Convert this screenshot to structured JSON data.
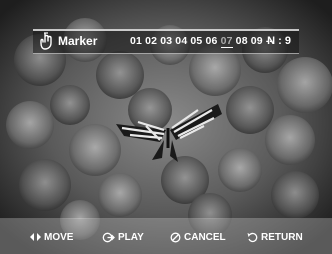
{
  "osd": {
    "title": "Marker",
    "title_icon": "marker-hand-icon",
    "chapters": [
      "01",
      "02",
      "03",
      "04",
      "05",
      "06",
      "07",
      "08",
      "09",
      "--"
    ],
    "selected_chapter": "07",
    "count": "N : 9"
  },
  "controls": {
    "move": {
      "label": "MOVE",
      "icon": "left-right-arrows-icon"
    },
    "play": {
      "label": "PLAY",
      "icon": "enter-icon"
    },
    "cancel": {
      "label": "CANCEL",
      "icon": "cancel-icon"
    },
    "return": {
      "label": "RETURN",
      "icon": "return-icon"
    }
  },
  "colors": {
    "overlay_dark": "#141414",
    "text": "#ffffff",
    "selected_text": "#aaaaaa"
  }
}
